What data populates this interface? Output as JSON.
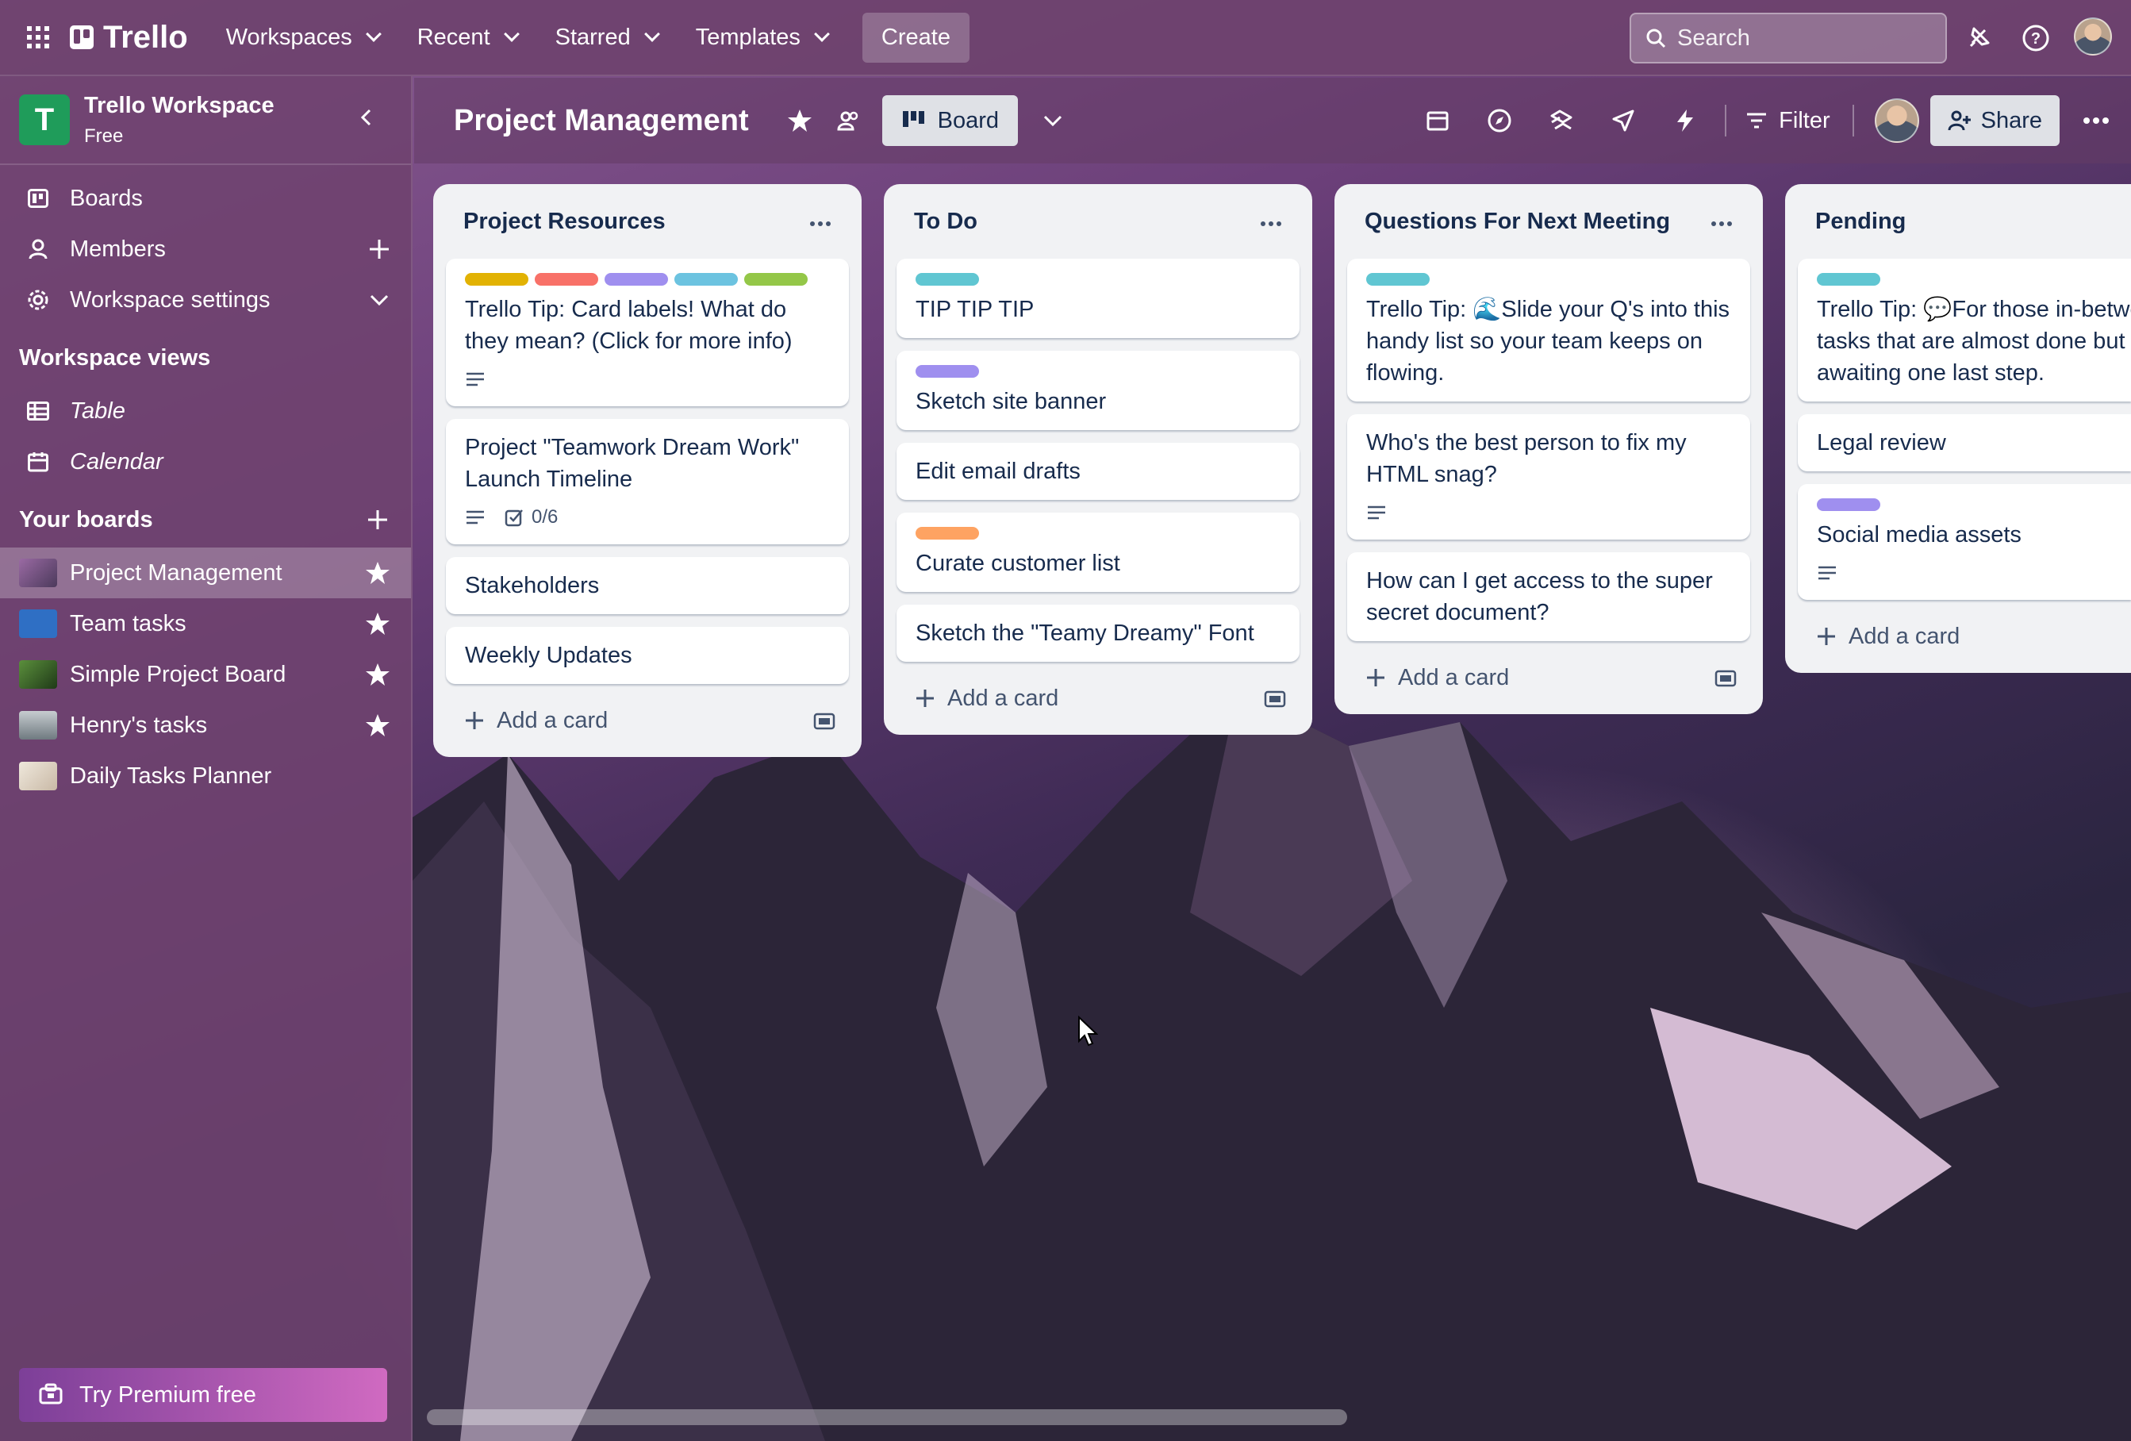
{
  "topbar": {
    "brand": "Trello",
    "nav": [
      "Workspaces",
      "Recent",
      "Starred",
      "Templates"
    ],
    "create_label": "Create",
    "search_placeholder": "Search"
  },
  "sidebar": {
    "workspace_initial": "T",
    "workspace_name": "Trello Workspace",
    "workspace_plan": "Free",
    "items": [
      {
        "label": "Boards",
        "icon": "board-icon"
      },
      {
        "label": "Members",
        "icon": "person-icon"
      },
      {
        "label": "Workspace settings",
        "icon": "gear-icon"
      }
    ],
    "views_title": "Workspace views",
    "views": [
      {
        "label": "Table",
        "icon": "table-icon"
      },
      {
        "label": "Calendar",
        "icon": "calendar-icon"
      }
    ],
    "boards_title": "Your boards",
    "boards": [
      {
        "label": "Project Management",
        "starred": true,
        "color": "#7b4f86"
      },
      {
        "label": "Team tasks",
        "starred": true,
        "color": "#2f6fc4"
      },
      {
        "label": "Simple Project Board",
        "starred": true,
        "color": "#3c6b2f"
      },
      {
        "label": "Henry's tasks",
        "starred": true,
        "color": "#9aa3a6"
      },
      {
        "label": "Daily Tasks Planner",
        "starred": false,
        "color": "#d9d2c7"
      }
    ],
    "premium_label": "Try Premium free"
  },
  "board": {
    "title": "Project Management",
    "view_label": "Board",
    "filter_label": "Filter",
    "share_label": "Share"
  },
  "lists": [
    {
      "title": "Project Resources",
      "cards": [
        {
          "labels": [
            "#e2b203",
            "#f87168",
            "#9f8fef",
            "#6cc3e0",
            "#94c748"
          ],
          "text": "Trello Tip: Card labels! What do they mean? (Click for more info)",
          "description": true
        },
        {
          "labels": [],
          "text": "Project \"Teamwork Dream Work\" Launch Timeline",
          "description": true,
          "checklist": "0/6"
        },
        {
          "labels": [],
          "text": "Stakeholders"
        },
        {
          "labels": [],
          "text": "Weekly Updates"
        }
      ],
      "add_label": "Add a card"
    },
    {
      "title": "To Do",
      "cards": [
        {
          "labels": [
            "#60c6d2"
          ],
          "text": "TIP TIP TIP"
        },
        {
          "labels": [
            "#9f8fef"
          ],
          "text": "Sketch site banner"
        },
        {
          "labels": [],
          "text": "Edit email drafts"
        },
        {
          "labels": [
            "#fea362"
          ],
          "text": "Curate customer list"
        },
        {
          "labels": [],
          "text": "Sketch the \"Teamy Dreamy\" Font"
        }
      ],
      "add_label": "Add a card"
    },
    {
      "title": "Questions For Next Meeting",
      "cards": [
        {
          "labels": [
            "#60c6d2"
          ],
          "text": "Trello Tip: 🌊Slide your Q's into this handy list so your team keeps on flowing."
        },
        {
          "labels": [],
          "text": "Who's the best person to fix my HTML snag?",
          "description": true
        },
        {
          "labels": [],
          "text": "How can I get access to the super secret document?"
        }
      ],
      "add_label": "Add a card"
    },
    {
      "title": "Pending",
      "cards": [
        {
          "labels": [
            "#60c6d2"
          ],
          "text": "Trello Tip: 💬For those in-between tasks that are almost done but awaiting one last step."
        },
        {
          "labels": [],
          "text": "Legal review"
        },
        {
          "labels": [
            "#9f8fef"
          ],
          "text": "Social media assets",
          "description": true
        }
      ],
      "add_label": "Add a card"
    }
  ]
}
